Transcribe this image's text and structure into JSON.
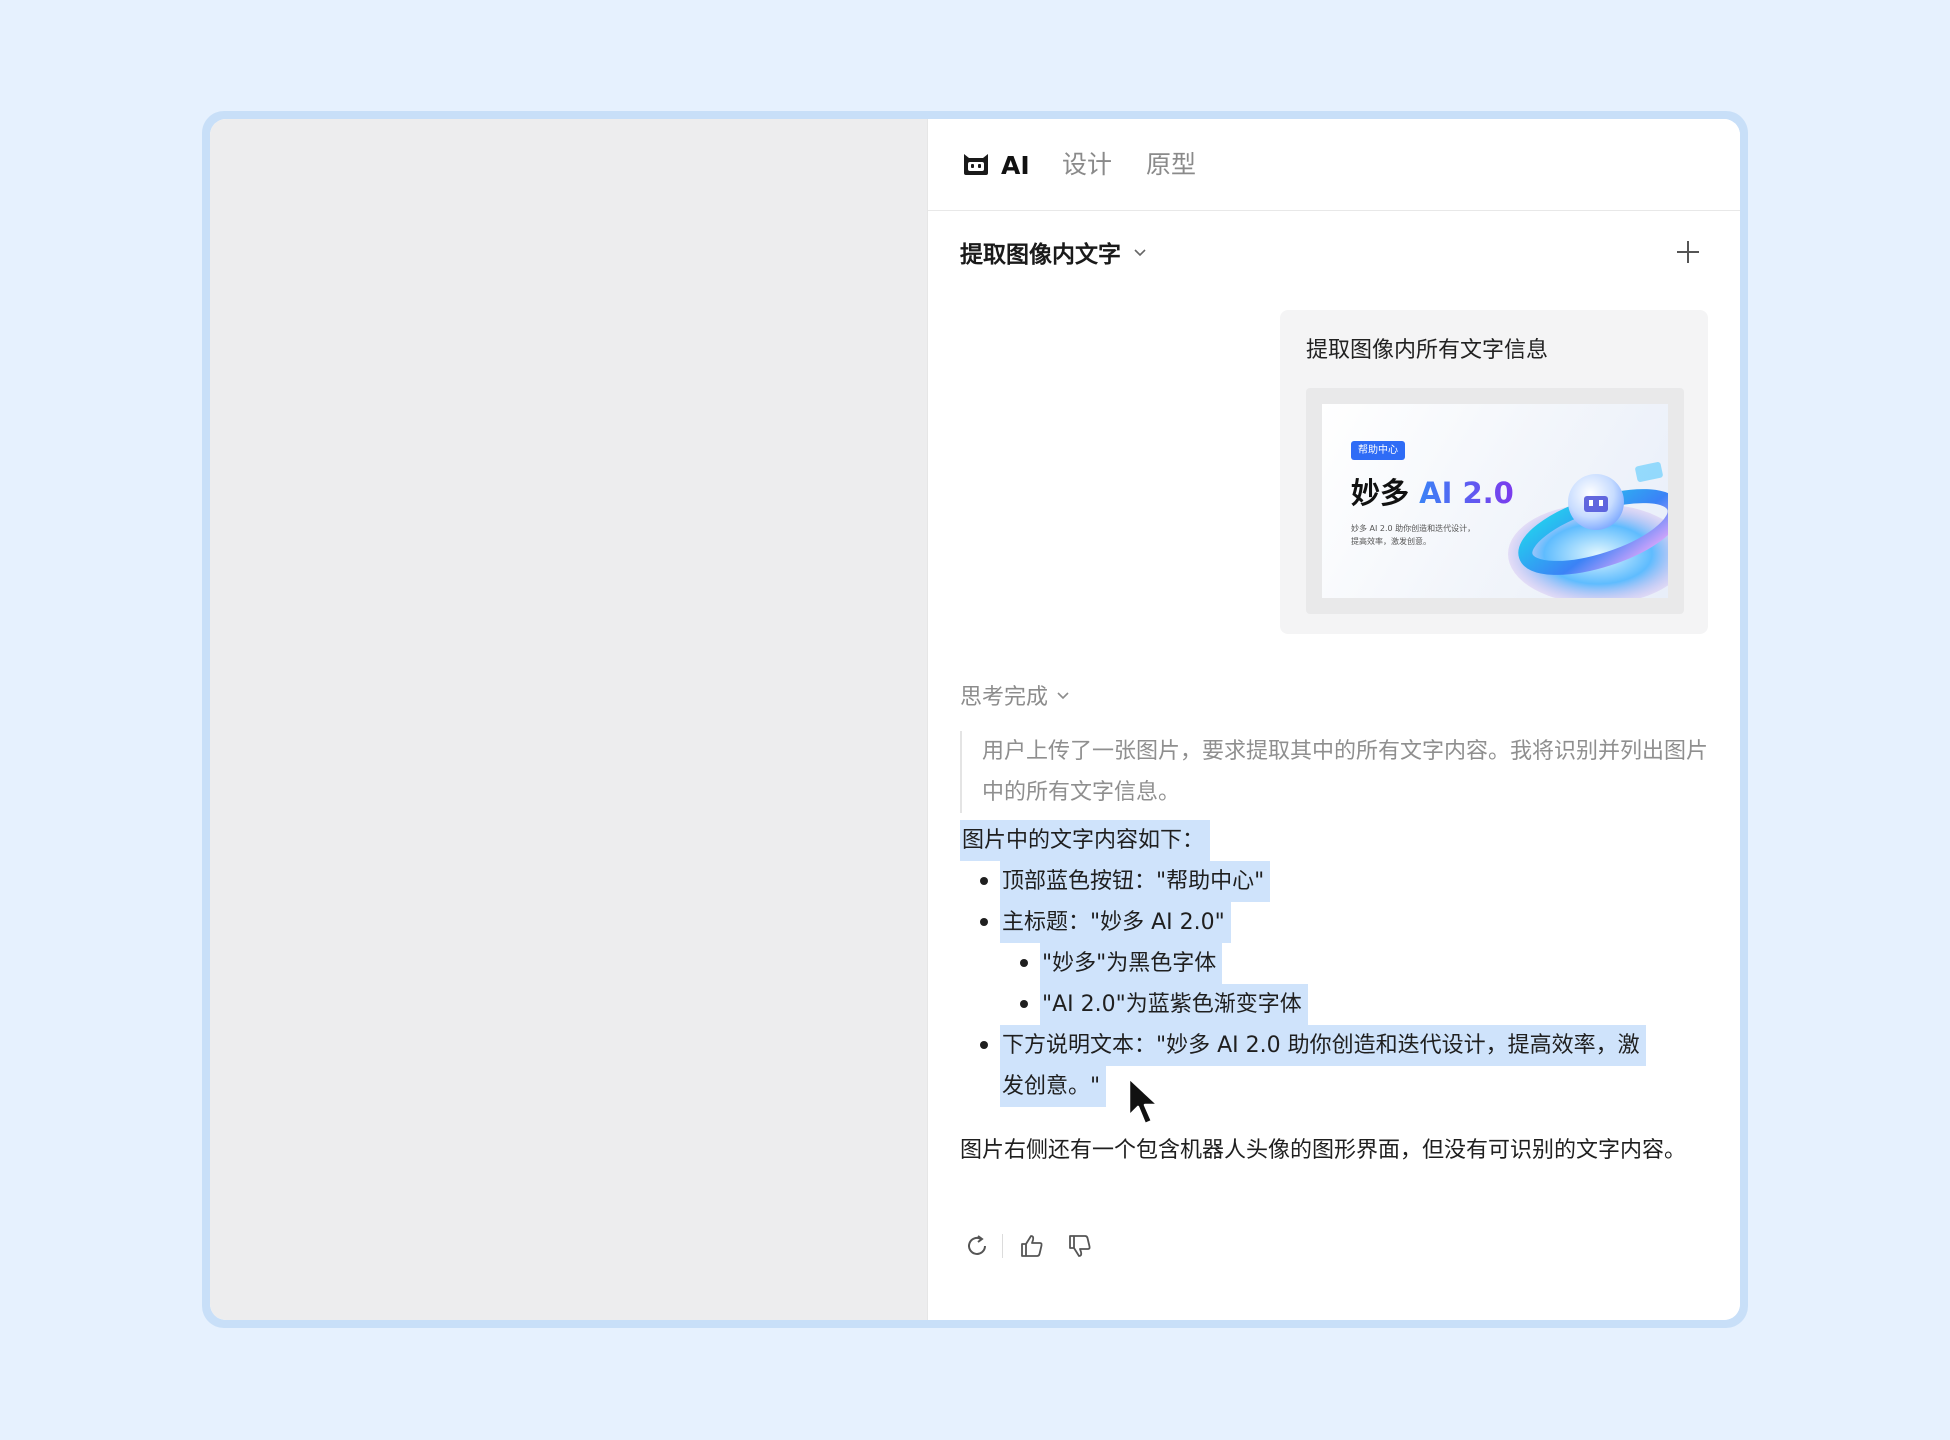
{
  "tabs": {
    "ai": "AI",
    "design": "设计",
    "prototype": "原型"
  },
  "session": {
    "title": "提取图像内文字"
  },
  "user_message": {
    "text": "提取图像内所有文字信息",
    "thumbnail": {
      "badge": "帮助中心",
      "title_black": "妙多",
      "title_gradient": "AI 2.0",
      "subtitle_line1": "妙多 AI 2.0 助你创造和迭代设计，",
      "subtitle_line2": "提高效率，激发创意。"
    }
  },
  "thinking": {
    "label": "思考完成",
    "text": "用户上传了一张图片，要求提取其中的所有文字内容。我将识别并列出图片中的所有文字信息。"
  },
  "answer": {
    "intro": "图片中的文字内容如下：",
    "item1": "顶部蓝色按钮：\"帮助中心\"",
    "item2": "主标题：\"妙多 AI 2.0\"",
    "item2_sub1": "\"妙多\"为黑色字体",
    "item2_sub2": "\"AI 2.0\"为蓝紫色渐变字体",
    "item3_line1": "下方说明文本：\"妙多 AI 2.0 助你创造和迭代设计，提高效率，激",
    "item3_line2": "发创意。\"",
    "closing": "图片右侧还有一个包含机器人头像的图形界面，但没有可识别的文字内容。"
  },
  "colors": {
    "page_bg": "#e6f1fe",
    "selection": "#cfe3fb",
    "badge_blue": "#2f6cf6"
  },
  "icons": {
    "ai_logo": "robot-cat-icon",
    "session_dropdown": "chevron-down-icon",
    "new_session": "plus-icon",
    "thinking_toggle": "chevron-down-icon",
    "regenerate": "refresh-icon",
    "like": "thumbs-up-icon",
    "dislike": "thumbs-down-icon"
  }
}
